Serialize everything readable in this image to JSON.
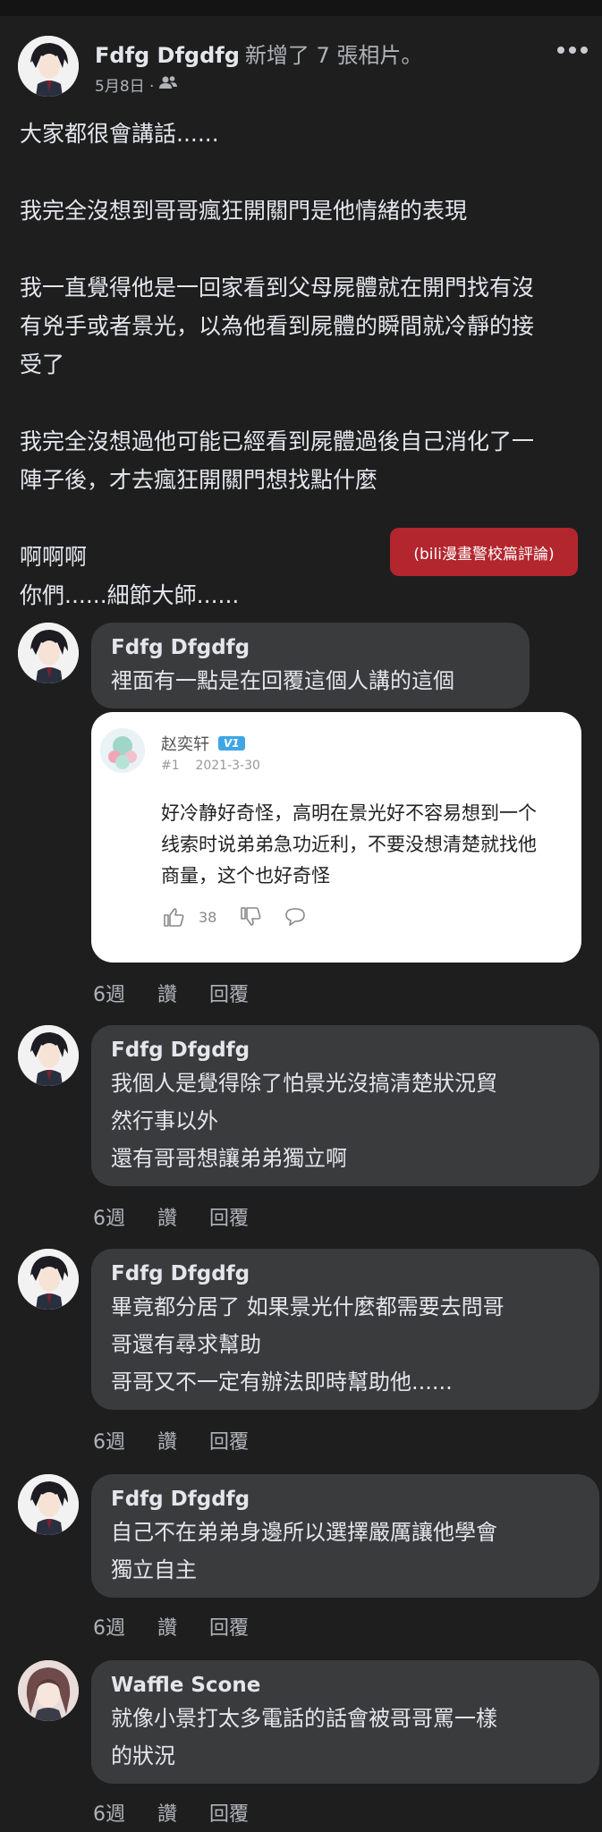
{
  "post": {
    "author": "Fdfg Dfgdfg",
    "action": "新增了 7 張相片。",
    "date": "5月8日 ·",
    "paragraphs": [
      [
        "大家都很會講話......"
      ],
      [
        "我完全沒想到哥哥瘋狂開關門是他情緒的表現"
      ],
      [
        "我一直覺得他是一回家看到父母屍體就在開門找有沒",
        "有兇手或者景光，以為他看到屍體的瞬間就冷靜的接",
        "受了"
      ],
      [
        "我完全沒想過他可能已經看到屍體過後自己消化了一",
        "陣子後，才去瘋狂開關門想找點什麼"
      ],
      [
        "啊啊啊",
        "你們......細節大師......"
      ]
    ],
    "label": "(bili漫畫警校篇評論)"
  },
  "quote": {
    "username": "赵奕轩",
    "badge": "V1",
    "floor": "#1",
    "date": "2021-3-30",
    "lines": [
      "好冷静好奇怪，高明在景光好不容易想到一个",
      "线索时说弟弟急功近利，不要没想清楚就找他",
      "商量，这个也好奇怪"
    ],
    "likes": "38"
  },
  "comments": [
    {
      "name": "Fdfg Dfgdfg",
      "lines": [
        "裡面有一點是在回覆這個人講的這個"
      ],
      "time": "6週",
      "like": "讚",
      "reply": "回覆"
    },
    {
      "name": "Fdfg Dfgdfg",
      "lines": [
        "我個人是覺得除了怕景光沒搞清楚狀況貿",
        "然行事以外",
        "還有哥哥想讓弟弟獨立啊"
      ],
      "time": "6週",
      "like": "讚",
      "reply": "回覆"
    },
    {
      "name": "Fdfg Dfgdfg",
      "lines": [
        "畢竟都分居了 如果景光什麼都需要去問哥",
        "哥還有尋求幫助",
        "哥哥又不一定有辦法即時幫助他......"
      ],
      "time": "6週",
      "like": "讚",
      "reply": "回覆"
    },
    {
      "name": "Fdfg Dfgdfg",
      "lines": [
        "自己不在弟弟身邊所以選擇嚴厲讓他學會",
        "獨立自主"
      ],
      "time": "6週",
      "like": "讚",
      "reply": "回覆"
    },
    {
      "name": "Waffle Scone",
      "lines": [
        "就像小景打太多電話的話會被哥哥罵一樣",
        "的狀況"
      ],
      "time": "6週",
      "like": "讚",
      "reply": "回覆"
    }
  ],
  "colors": {
    "background": "#1e1e1f",
    "bubble": "#3a3b3c",
    "label": "#b3262d",
    "secondary_text": "#b0b3b8"
  },
  "icons": [
    "more-icon",
    "friends-audience-icon",
    "thumb-up-icon",
    "thumb-down-icon",
    "comment-icon"
  ]
}
